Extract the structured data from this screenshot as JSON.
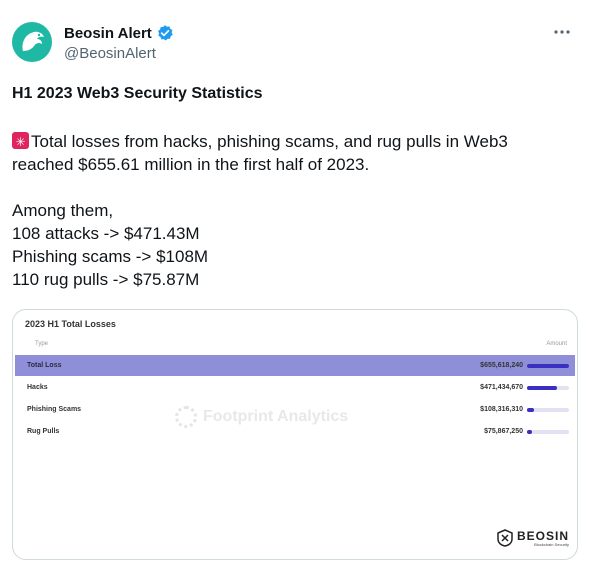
{
  "author": {
    "display_name": "Beosin Alert",
    "handle": "@BeosinAlert",
    "verified": true
  },
  "more_icon": "ellipsis-icon",
  "tweet": {
    "title": "H1 2023 Web3 Security Statistics",
    "lines": [
      "Total losses from hacks, phishing scams, and rug pulls in Web3",
      "reached $655.61 million in the first half of 2023."
    ],
    "among": "Among them,",
    "items": [
      "108 attacks  -> $471.43M",
      "Phishing scams ->  $108M",
      "110 rug pulls -> $75.87M"
    ]
  },
  "card": {
    "title": "2023 H1 Total Losses",
    "col_type": "Type",
    "col_amount": "Amount",
    "watermark": "Footprint Analytics",
    "brand": "BEOSIN",
    "brand_sub": "Blockchain Security"
  },
  "chart_data": {
    "type": "table",
    "title": "2023 H1 Total Losses",
    "columns": [
      "Type",
      "Amount"
    ],
    "rows": [
      {
        "type": "Total Loss",
        "amount_label": "$655,618,240",
        "amount": 655618240
      },
      {
        "type": "Hacks",
        "amount_label": "$471,434,670",
        "amount": 471434670
      },
      {
        "type": "Phishing Scams",
        "amount_label": "$108,316,310",
        "amount": 108316310
      },
      {
        "type": "Rug Pulls",
        "amount_label": "$75,867,250",
        "amount": 75867250
      }
    ]
  },
  "colors": {
    "highlight_row": "#8f8fd9",
    "bar": "#3a2fc0",
    "avatar": "#1fb8a4",
    "verified": "#1d9bf0"
  }
}
